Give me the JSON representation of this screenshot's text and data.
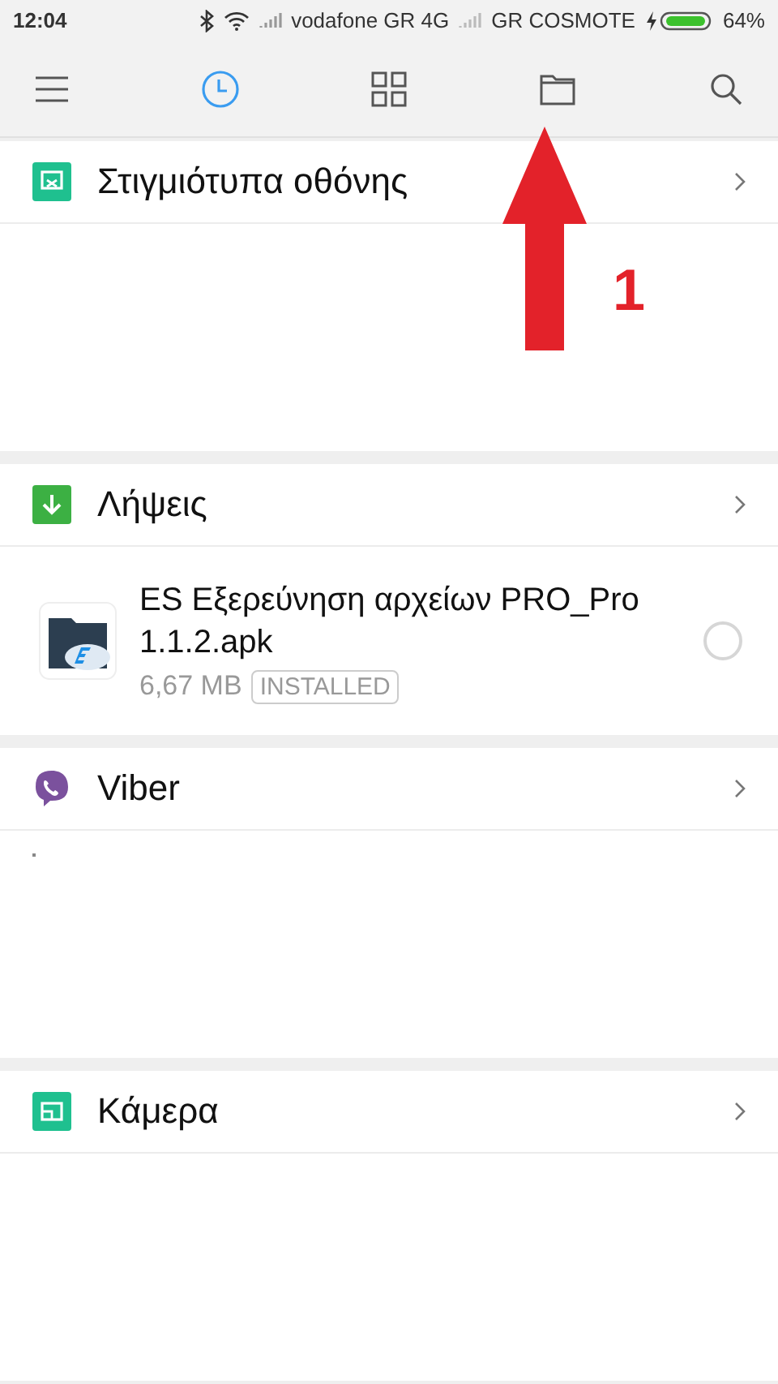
{
  "status_bar": {
    "time": "12:04",
    "carrier_1": "vodafone GR 4G",
    "carrier_2": "GR COSMOTE",
    "battery": "64%"
  },
  "toolbar": {
    "items": [
      {
        "kind": "menu",
        "selected": false
      },
      {
        "kind": "recent",
        "selected": true
      },
      {
        "kind": "categories",
        "selected": false
      },
      {
        "kind": "folder",
        "selected": false
      },
      {
        "kind": "search",
        "selected": false
      }
    ]
  },
  "sections": [
    {
      "kind": "screenshots",
      "title": "Στιγμιότυπα οθόνης",
      "color": "#1fc08f"
    },
    {
      "kind": "downloads",
      "title": "Λήψεις",
      "color": "#3cb043",
      "files": [
        {
          "name": "ES Εξερεύνηση αρχείων PRO_Pro 1.1.2.apk",
          "size": "6,67 MB",
          "badge": "INSTALLED",
          "selected": false
        }
      ]
    },
    {
      "kind": "viber",
      "title": "Viber",
      "color": "#7b519d"
    },
    {
      "kind": "camera",
      "title": "Κάμερα",
      "color": "#1fc08f"
    }
  ],
  "annotation": {
    "label": "1"
  }
}
